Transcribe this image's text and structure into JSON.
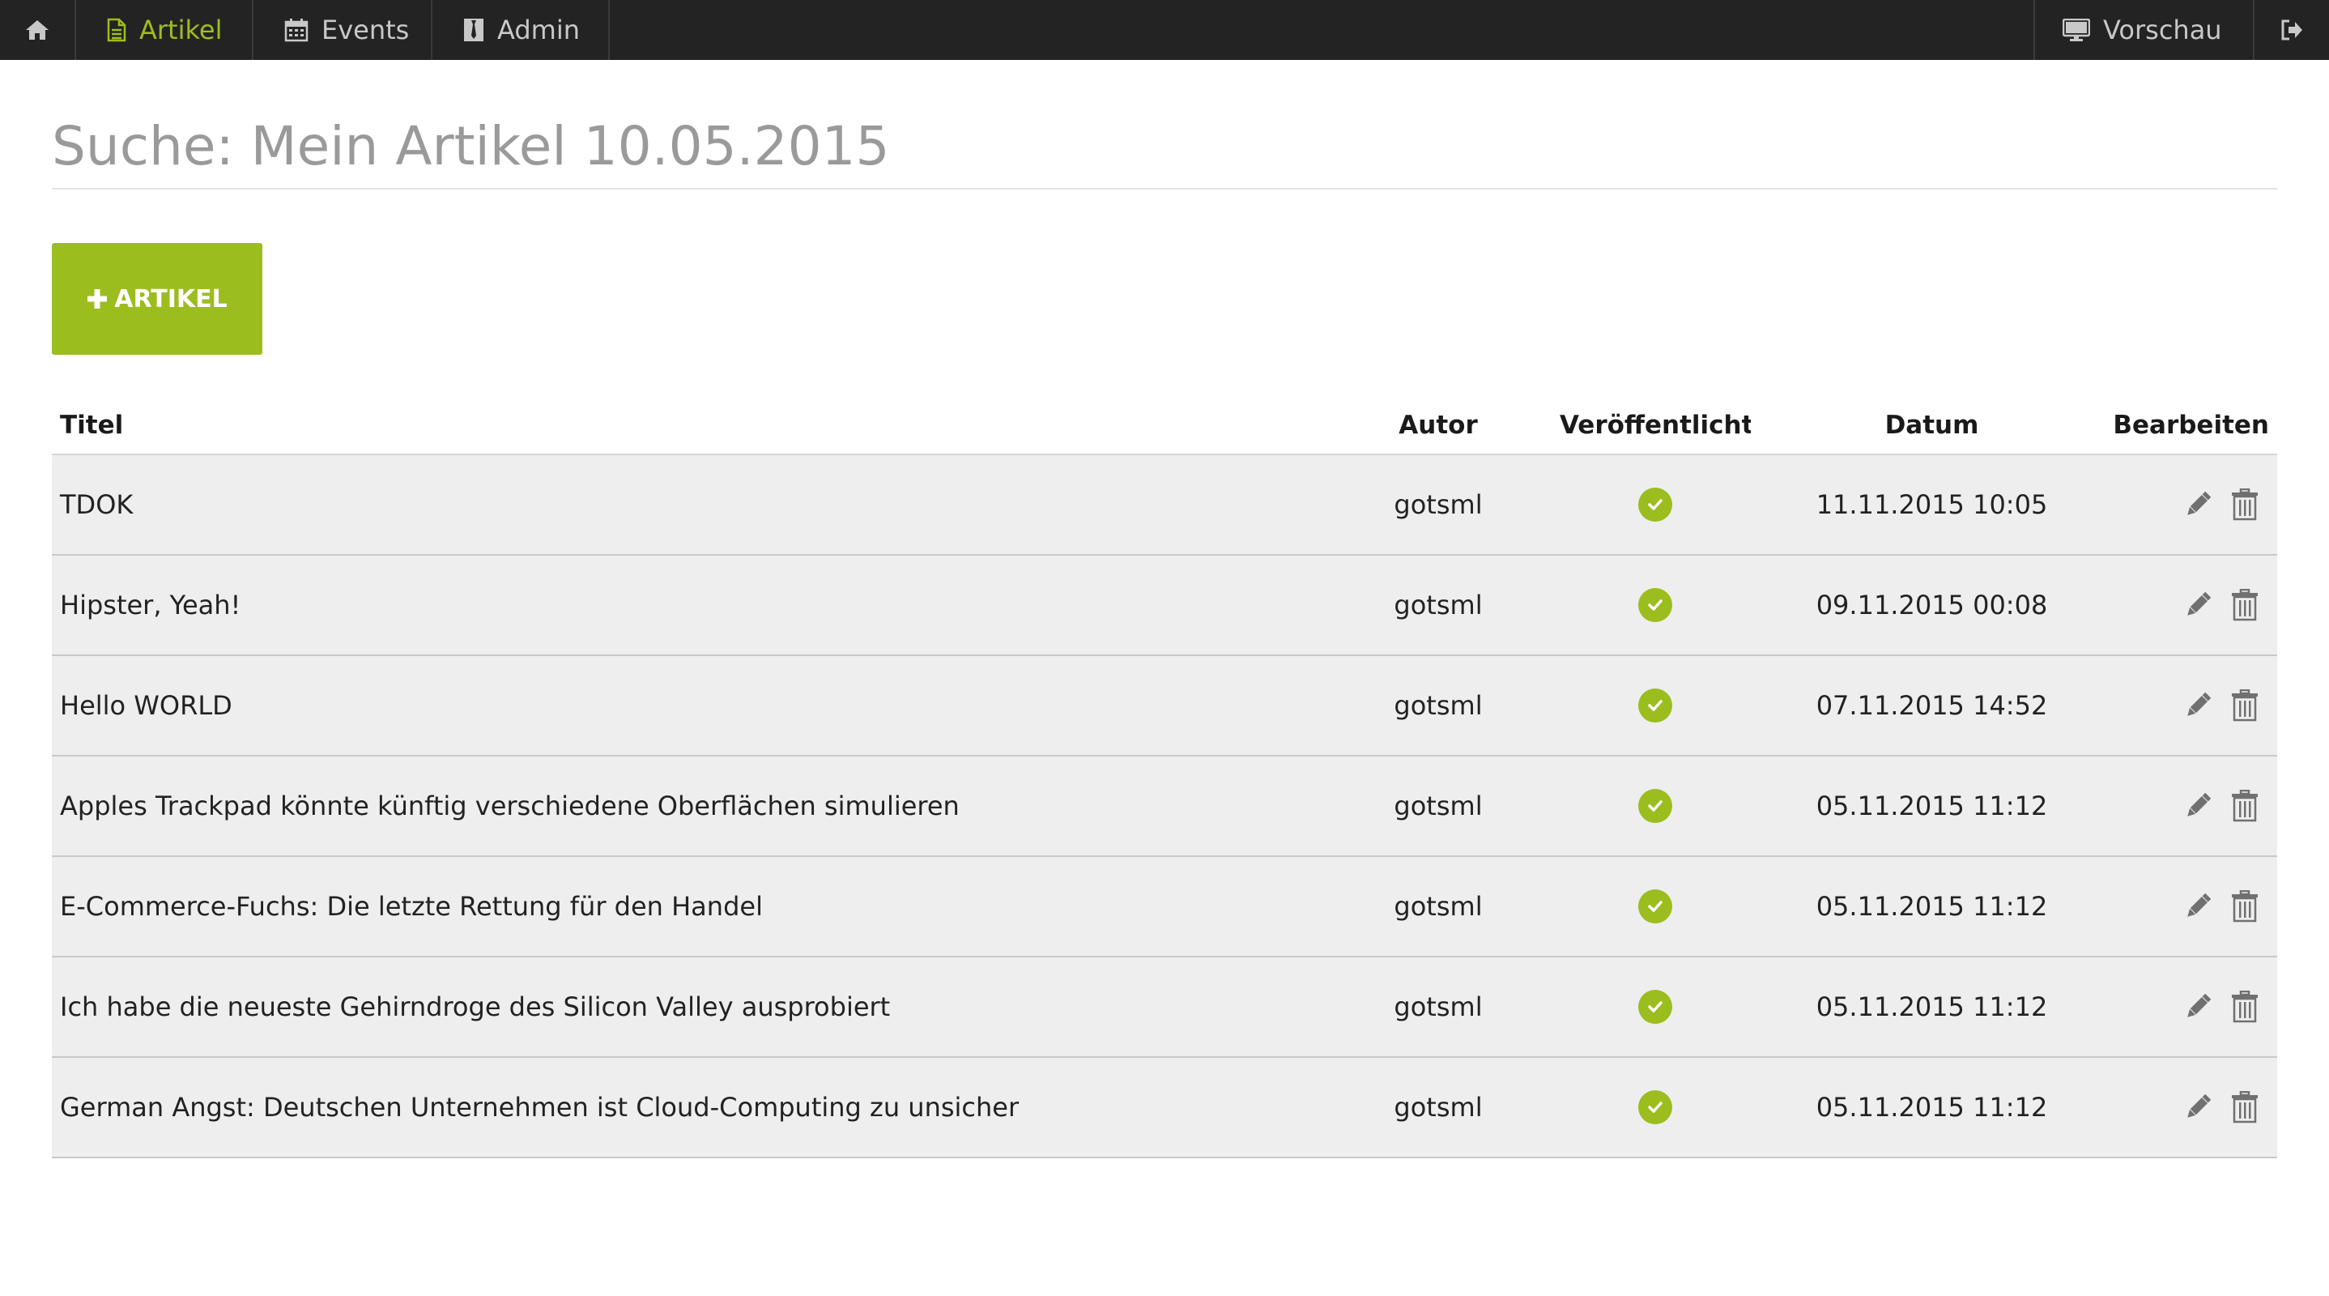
{
  "nav": {
    "home_icon": "home-icon",
    "items": [
      {
        "label": "Artikel",
        "icon": "document-icon",
        "active": true
      },
      {
        "label": "Events",
        "icon": "calendar-icon",
        "active": false
      },
      {
        "label": "Admin",
        "icon": "tie-icon",
        "active": false
      }
    ],
    "preview": {
      "label": "Vorschau",
      "icon": "monitor-icon"
    },
    "logout_icon": "sign-out-icon"
  },
  "page": {
    "title": "Suche: Mein Artikel 10.05.2015",
    "add_button_label": "ARTIKEL",
    "add_button_icon": "plus-icon"
  },
  "table": {
    "headers": {
      "title": "Titel",
      "author": "Autor",
      "published": "Veröffentlicht",
      "date": "Datum",
      "edit": "Bearbeiten"
    },
    "rows": [
      {
        "title": "TDOK",
        "author": "gotsml",
        "published": true,
        "date": "11.11.2015 10:05"
      },
      {
        "title": "Hipster, Yeah!",
        "author": "gotsml",
        "published": true,
        "date": "09.11.2015 00:08"
      },
      {
        "title": "Hello WORLD",
        "author": "gotsml",
        "published": true,
        "date": "07.11.2015 14:52"
      },
      {
        "title": "Apples Trackpad könnte künftig verschiedene Oberflächen simulieren",
        "author": "gotsml",
        "published": true,
        "date": "05.11.2015 11:12"
      },
      {
        "title": "E-Commerce-Fuchs: Die letzte Rettung für den Handel",
        "author": "gotsml",
        "published": true,
        "date": "05.11.2015 11:12"
      },
      {
        "title": "Ich habe die neueste Gehirndroge des Silicon Valley ausprobiert",
        "author": "gotsml",
        "published": true,
        "date": "05.11.2015 11:12"
      },
      {
        "title": "German Angst: Deutschen Unternehmen ist Cloud-Computing zu unsicher",
        "author": "gotsml",
        "published": true,
        "date": "05.11.2015 11:12"
      }
    ]
  },
  "colors": {
    "accent": "#9bbd1e",
    "nav_background": "#232323",
    "row_background": "#eeeeee",
    "title_text": "#9a9a9a"
  }
}
